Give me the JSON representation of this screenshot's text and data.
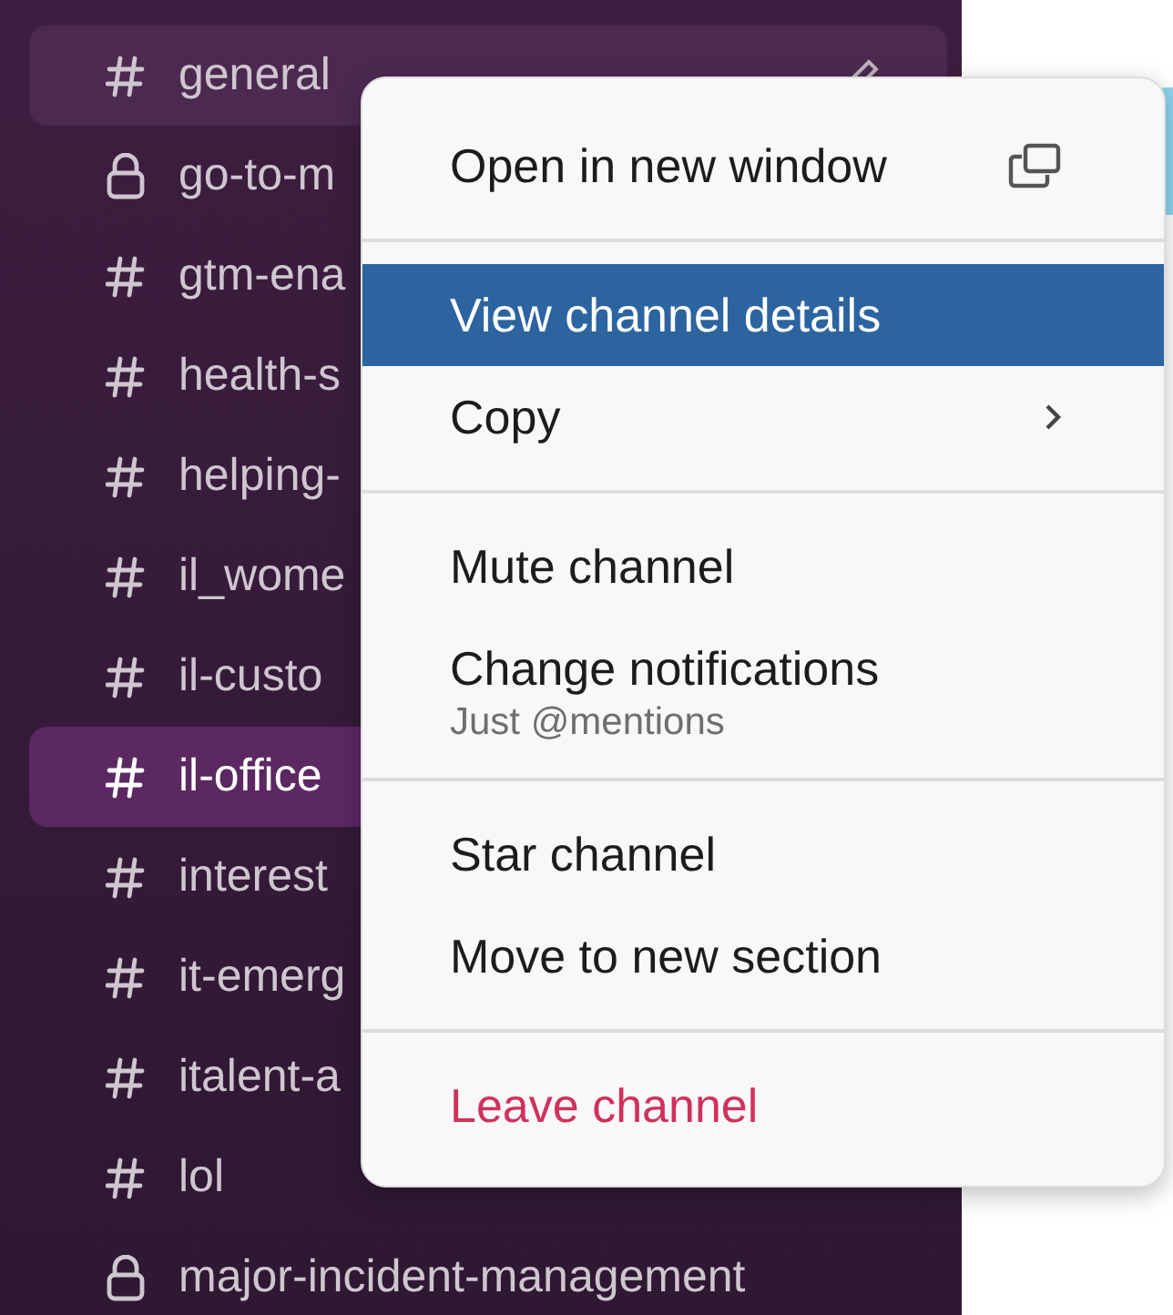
{
  "sidebar": {
    "channels": [
      {
        "name": "general",
        "kind": "public",
        "selected": false,
        "hovered": true
      },
      {
        "name": "go-to-m",
        "kind": "private",
        "selected": false,
        "hovered": false
      },
      {
        "name": "gtm-ena",
        "kind": "public",
        "selected": false,
        "hovered": false
      },
      {
        "name": "health-s",
        "kind": "public",
        "selected": false,
        "hovered": false
      },
      {
        "name": "helping-",
        "kind": "public",
        "selected": false,
        "hovered": false
      },
      {
        "name": "il_wome",
        "kind": "public",
        "selected": false,
        "hovered": false
      },
      {
        "name": "il-custo",
        "kind": "public",
        "selected": false,
        "hovered": false
      },
      {
        "name": "il-office",
        "kind": "public",
        "selected": true,
        "hovered": false
      },
      {
        "name": "interest",
        "kind": "public",
        "selected": false,
        "hovered": false
      },
      {
        "name": "it-emerg",
        "kind": "public",
        "selected": false,
        "hovered": false
      },
      {
        "name": "italent-a",
        "kind": "public",
        "selected": false,
        "hovered": false
      },
      {
        "name": "lol",
        "kind": "public",
        "selected": false,
        "hovered": false
      },
      {
        "name": "major-incident-management",
        "kind": "private",
        "selected": false,
        "hovered": false
      }
    ]
  },
  "context_menu": {
    "groups": [
      [
        {
          "label": "Open in new window",
          "kind": "window",
          "selected": false
        }
      ],
      [
        {
          "label": "View channel details",
          "kind": "plain",
          "selected": true
        },
        {
          "label": "Copy",
          "kind": "submenu",
          "selected": false
        }
      ],
      [
        {
          "label": "Mute channel",
          "kind": "plain",
          "selected": false
        },
        {
          "label": "Change notifications",
          "kind": "plain",
          "selected": false,
          "sublabel": "Just @mentions"
        }
      ],
      [
        {
          "label": "Star channel",
          "kind": "plain",
          "selected": false
        },
        {
          "label": "Move to new section",
          "kind": "plain",
          "selected": false
        }
      ],
      [
        {
          "label": "Leave channel",
          "kind": "danger",
          "selected": false
        }
      ]
    ]
  }
}
